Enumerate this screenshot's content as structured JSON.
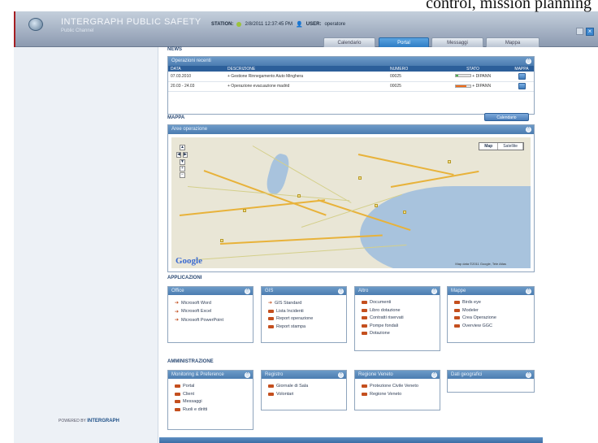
{
  "caption": "control, mission planning",
  "app": {
    "brand": "INTERGRAPH PUBLIC SAFETY",
    "brand_sub": "Public Channel",
    "station_label": "STATION:",
    "station_value": "2/8/2011 12:37:45 PM",
    "user_label": "USER:",
    "user_value": "operatore"
  },
  "tabs": [
    {
      "label": "Calendario",
      "active": false
    },
    {
      "label": "Portal",
      "active": true
    },
    {
      "label": "Messaggi",
      "active": false
    },
    {
      "label": "Mappa",
      "active": false
    }
  ],
  "sections": {
    "news": "NEWS",
    "mappa": "MAPPA",
    "applicazioni": "APPLICAZIONI",
    "amministrazione": "AMMINISTRAZIONE"
  },
  "operations": {
    "title": "Operazioni recenti",
    "columns": [
      "DATA",
      "DESCRIZIONE",
      "NUMERO",
      "STATO",
      "MAPPA"
    ],
    "rows": [
      {
        "date": "07.03.2010",
        "desc": "+ Gestione Rinnegamento Aiuto Minghera",
        "num": "00025",
        "status": "+ DIPANN",
        "progress": 0.2,
        "color": "#4caf50"
      },
      {
        "date": "20.03 - 24.03",
        "desc": "+ Operazione evacuazione madrid",
        "num": "00025",
        "status": "+ DIPANN",
        "progress": 0.75,
        "color": "#ef6c1a"
      }
    ],
    "calendar_button": "Calendario"
  },
  "map": {
    "title": "Aree operazione",
    "toggle": [
      "Map",
      "Satellite"
    ],
    "logo": "Google",
    "copyright": "Map data ©2011 Google, Tele Atlas"
  },
  "applications": [
    {
      "title": "Office",
      "icon": "arrow",
      "items": [
        "Microsoft Word",
        "Microsoft Excel",
        "Microsoft PowerPoint"
      ]
    },
    {
      "title": "GIS",
      "icon": "arrow",
      "items": [
        "GIS Standard",
        "Lista Incidenti",
        "Report operazione",
        "Report stampa"
      ]
    },
    {
      "title": "Altro",
      "icon": "folder",
      "items": [
        "Documenti",
        "Libro dotazione",
        "Contratti riservati",
        "Pompe fondali",
        "Dotazione"
      ]
    },
    {
      "title": "Mappe",
      "icon": "folder",
      "items": [
        "Birds eye",
        "Modeler",
        "Crea Operazione",
        "Overview GGC"
      ]
    }
  ],
  "administration": [
    {
      "title": "Monitoring & Preference",
      "items": [
        "Portal",
        "Client",
        "Messaggi",
        "Ruoli e diritti"
      ]
    },
    {
      "title": "Registro",
      "items": [
        "Giornale di Sala",
        "Volontari"
      ]
    },
    {
      "title": "Regione Veneto",
      "items": [
        "Protezione Civile Veneto",
        "Regione Veneto"
      ]
    },
    {
      "title": "Dati geografici",
      "items": []
    }
  ],
  "footer": {
    "powered_by": "POWERED BY",
    "vendor": "INTERGRAPH"
  }
}
